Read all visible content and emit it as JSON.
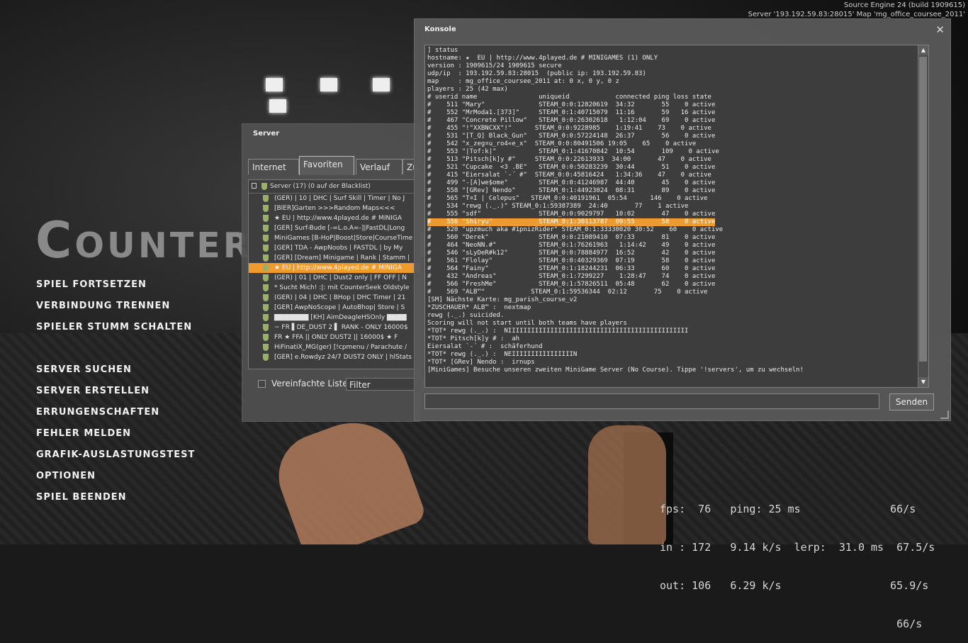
{
  "engine_info": {
    "line1": "Source Engine 24 (build 1909615)",
    "line2": "Server '193.192.59.83:28015' Map 'mg_office_coursee_2011'"
  },
  "logo_text": "Counter-Strike",
  "menu": {
    "items": [
      "SPIEL FORTSETZEN",
      "VERBINDUNG TRENNEN",
      "SPIELER STUMM SCHALTEN",
      "SERVER SUCHEN",
      "SERVER ERSTELLEN",
      "ERRUNGENSCHAFTEN",
      "FEHLER MELDEN",
      "GRAFIK-AUSLASTUNGSTEST",
      "OPTIONEN",
      "SPIEL BEENDEN"
    ]
  },
  "server_browser": {
    "title": "Server",
    "tabs": [
      "Internet",
      "Favoriten",
      "Verlauf",
      "Zu"
    ],
    "active_tab": 1,
    "list_header": "Server (17) (0 auf der Blacklist)",
    "rows": [
      "(GER) | 10 | DHC | Surf Skill | Timer | No J",
      "[BlER]Garten >>>Random Maps<<<",
      "★ EU | http://www.4played.de # MINIGA",
      "[GER] Surf-Bude [-=L.o.A=-]|FastDL|Long",
      "MiniGames [B-HoP|Boost|Store|CourseTime",
      "[GER] TDA - AwpNoobs | FASTDL | by My",
      "[GER] [Dream] Minigame | Rank | Stamm |",
      "★ EU | http://www.4played.de # MINIGA",
      "(GER) | 01 | DHC | Dust2 only | FF OFF | N",
      "* Sucht Mich! :|: mit CounterSeek Oldstyle",
      "(GER) | 04 | DHC | BHop | DHC Timer | 21",
      "[GER] AwpNoScope | AutoBhop| Store | S",
      "▇▇▇▇▇▇▇ [KH] AimDeagleHSOnly ▇▇▇▇",
      "~ FR ▌DE_DUST 2 ▌ RANK - ONLY 16000$",
      "FR ★ FFA || ONLY DUST2 || 16000$ ★ F",
      "HiFinatiX_MG(ger) [!cpmenu / Parachute /",
      "[GER] e.Rowdyz 24/7 DUST2 ONLY | hlStats"
    ],
    "selected_row": 7,
    "simplified_label": "Vereinfachte Liste",
    "filter_label": "Filter"
  },
  "console": {
    "title": "Konsole",
    "close_glyph": "✕",
    "lines": [
      "] status",
      "hostname: ★  EU | http://www.4played.de # MINIGAMES (1) ONLY",
      "version : 1909615/24 1909615 secure",
      "udp/ip  : 193.192.59.83:28015  (public ip: 193.192.59.83)",
      "map     : mg_office_coursee_2011 at: 0 x, 0 y, 0 z",
      "players : 25 (42 max)",
      "",
      "# userid name                uniqueid            connected ping loss state",
      "#    511 \"Mary\"              STEAM_0:0:12820619  34:32       55    0 active",
      "#    552 \"MrModa1.[373]\"     STEAM_0:1:40715079  11:16       59   16 active",
      "#    467 \"Concrete Pillow\"   STEAM_0:0:26302618   1:12:04    69    0 active",
      "#    455 \"!\"XXBNCXX\"!\"      STEAM_0:0:9228985    1:19:41    73    0 active",
      "#    531 \"[T_Q] Black_Gun\"   STEAM_0:0:57224148  26:37       56    0 active",
      "#    542 \"x_zeg¤u_ro4«e_x\"  STEAM_0:0:80491506 19:05    65    0 active",
      "#    553 \"|Tof:k|\"           STEAM_0:1:41670842  10:54       109    0 active",
      "#    513 \"Pitsch[k]y #\"     STEAM_0:0:22613933  34:00       47    0 active",
      "#    521 \"Cupcake  <3 .BE\"   STEAM_0:0:50283239  30:44       51    0 active",
      "#    415 \"Eiersalat `-´ #\"  STEAM_0:0:45816424   1:34:36    47    0 active",
      "#    499 \"-[A]we$ome\"        STEAM_0:0:41246987  44:40       45    0 active",
      "#    558 \"[GRev] Nendo\"      STEAM_0:1:44923024  08:31       89    0 active",
      "#    565 \"T¤I | Celepus\"   STEAM_0:0:40191961  05:54      146    0 active",
      "#    534 \"rewg (._.)\" STEAM_0:1:59387389  24:40       77    1 active",
      "#    555 \"sdf\"               STEAM_0:0:9029797   10:02       47    0 active",
      "#    556 \"Shiryu\"            STEAM_0:1:30113787  09:55       58    0 active",
      "#    520 \"upzmuch aka #1pnizRider\" STEAM_0:1:33330020 30:52    60    0 active",
      "#    560 \"Derek\"             STEAM_0:0:21089410  07:33       81    0 active",
      "#    464 \"NeoNN.#\"           STEAM_0:1:76261963   1:14:42    49    0 active",
      "#    546 \"sLyDeR#k12\"        STEAM_0:0:78884977  16:52       42    0 active",
      "#    561 \"Flolay\"            STEAM_0:0:40329369  07:19       58    0 active",
      "#    564 \"Fainy\"             STEAM_0:1:18244231  06:33       60    0 active",
      "#    432 \"Andreas\"           STEAM_0:1:7299227    1:28:47    74    0 active",
      "#    566 \"FreshMe\"           STEAM_0:1:57826511  05:48       62    0 active",
      "#    569 \"ALB™\"            STEAM_0:1:59536344  02:12       75    0 active",
      "[SM] Nächste Karte: mg_parish_course_v2",
      "*ZUSCHAUER* ALB™ :  nextmap",
      "rewg (._.) suicided.",
      "Scoring will not start until both teams have players",
      "*TOT* rewg (._.) :  NIIIIIIIIIIIIIIIIIIIIIIIIIIIIIIIIIIIIIIIIIIIIIII",
      "*TOT* Pitsch[k]y # :  ah",
      "Eiersalat `-´ # :  schäferhund",
      "*TOT* rewg (._.) :  NEIIIIIIIIIIIIIIIIN",
      "*TOT* [GRev] Nendo :  irnups",
      "[MiniGames] Besuche unseren zweiten MiniGame Server (No Course). Tippe '!servers', um zu wechseln!"
    ],
    "highlight_line": 23,
    "send_label": "Senden"
  },
  "netgraph": {
    "line1": "fps:  76   ping: 25 ms              66/s",
    "line2": "in : 172   9.14 k/s  lerp:  31.0 ms  67.5/s",
    "line3": "out: 106   6.29 k/s                 65.9/s",
    "line4": "                                     66/s"
  }
}
